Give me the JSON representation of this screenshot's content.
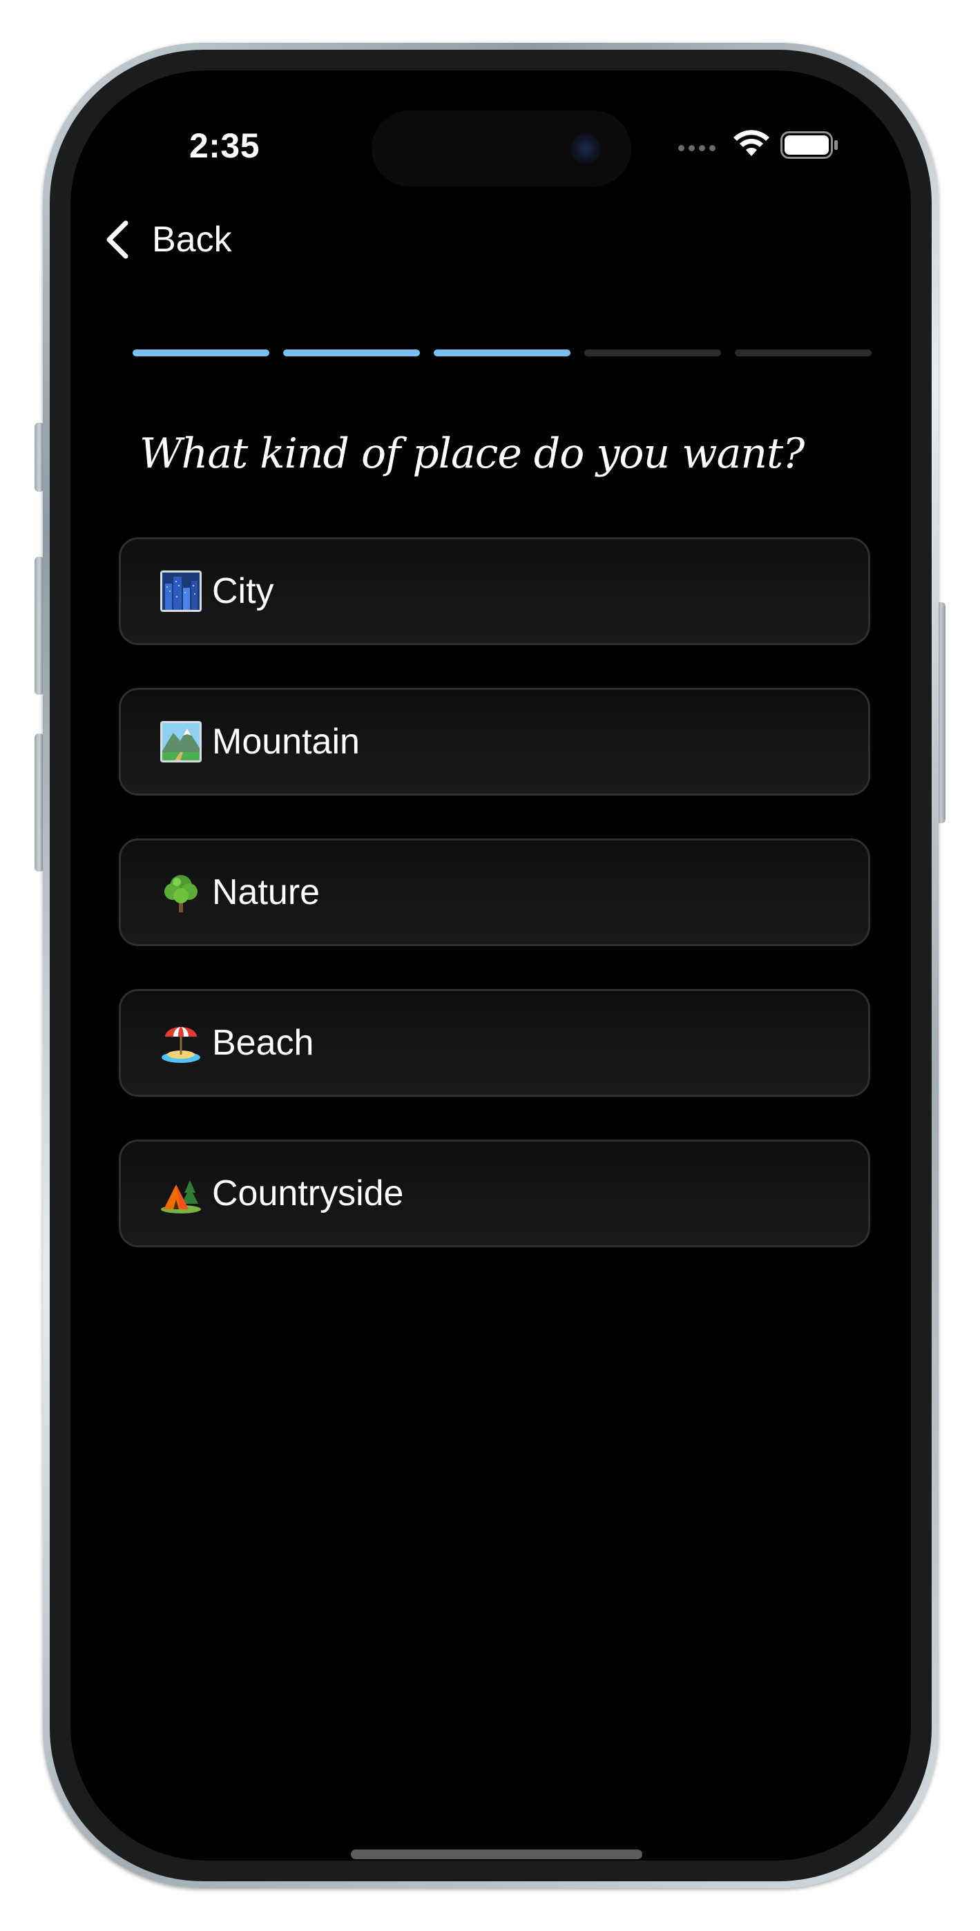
{
  "status_bar": {
    "time": "2:35",
    "signal_icon": "signal-dots-icon",
    "wifi_icon": "wifi-icon",
    "battery_icon": "battery-icon"
  },
  "nav": {
    "back_label": "Back",
    "back_icon": "chevron-left-icon"
  },
  "progress": {
    "steps_total": 5,
    "steps_completed": 3,
    "active_color": "#7cc0f0",
    "inactive_color": "#2b2b2e"
  },
  "question": "What kind of place do you want?",
  "options": [
    {
      "label": "City",
      "icon": "cityscape-emoji-icon"
    },
    {
      "label": "Mountain",
      "icon": "national-park-emoji-icon"
    },
    {
      "label": "Nature",
      "icon": "tree-emoji-icon"
    },
    {
      "label": "Beach",
      "icon": "beach-umbrella-emoji-icon"
    },
    {
      "label": "Countryside",
      "icon": "camping-emoji-icon"
    }
  ]
}
